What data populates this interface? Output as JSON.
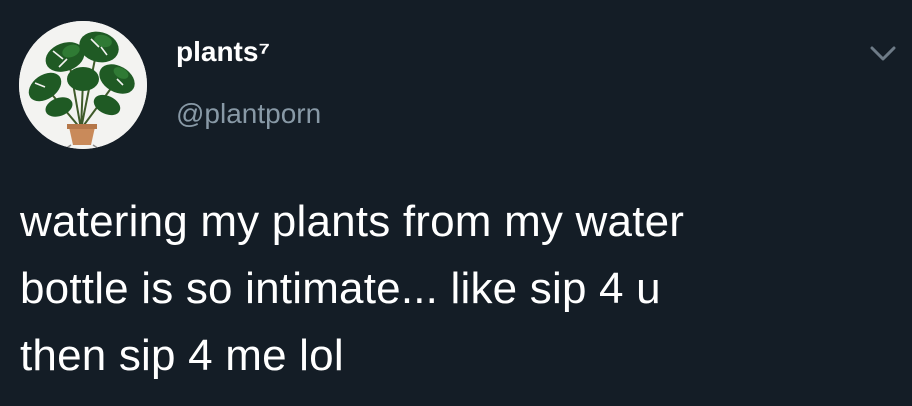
{
  "tweet": {
    "display_name": "plants⁷",
    "handle": "@plantporn",
    "text": "watering my plants from my water\nbottle is so intimate... like sip 4 u\nthen sip 4 me lol",
    "avatar_icon": "monstera-plant-icon",
    "menu_icon": "chevron-down-icon"
  },
  "colors": {
    "background": "#141d26",
    "text": "#ffffff",
    "secondary": "#8899a6"
  }
}
